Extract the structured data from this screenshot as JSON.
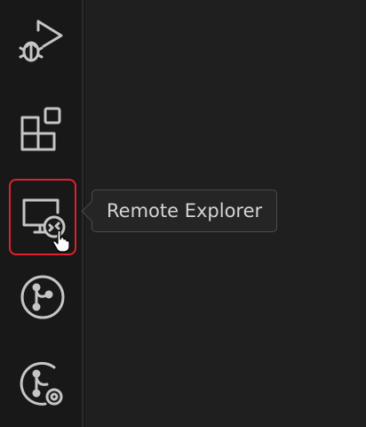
{
  "activity_bar": {
    "items": [
      {
        "icon": "run-debug-icon",
        "state": "inactive"
      },
      {
        "icon": "extensions-icon",
        "state": "inactive"
      },
      {
        "icon": "remote-explorer-icon",
        "state": "hovered-highlighted"
      },
      {
        "icon": "source-control-icon",
        "state": "inactive"
      },
      {
        "icon": "git-graph-icon",
        "state": "inactive"
      }
    ]
  },
  "tooltip": {
    "text": "Remote Explorer"
  },
  "colors": {
    "background": "#181818",
    "icon": "#c5c5c5",
    "highlight_border": "#e0202e",
    "tooltip_bg": "#252526",
    "tooltip_text": "#d4d4d4"
  }
}
